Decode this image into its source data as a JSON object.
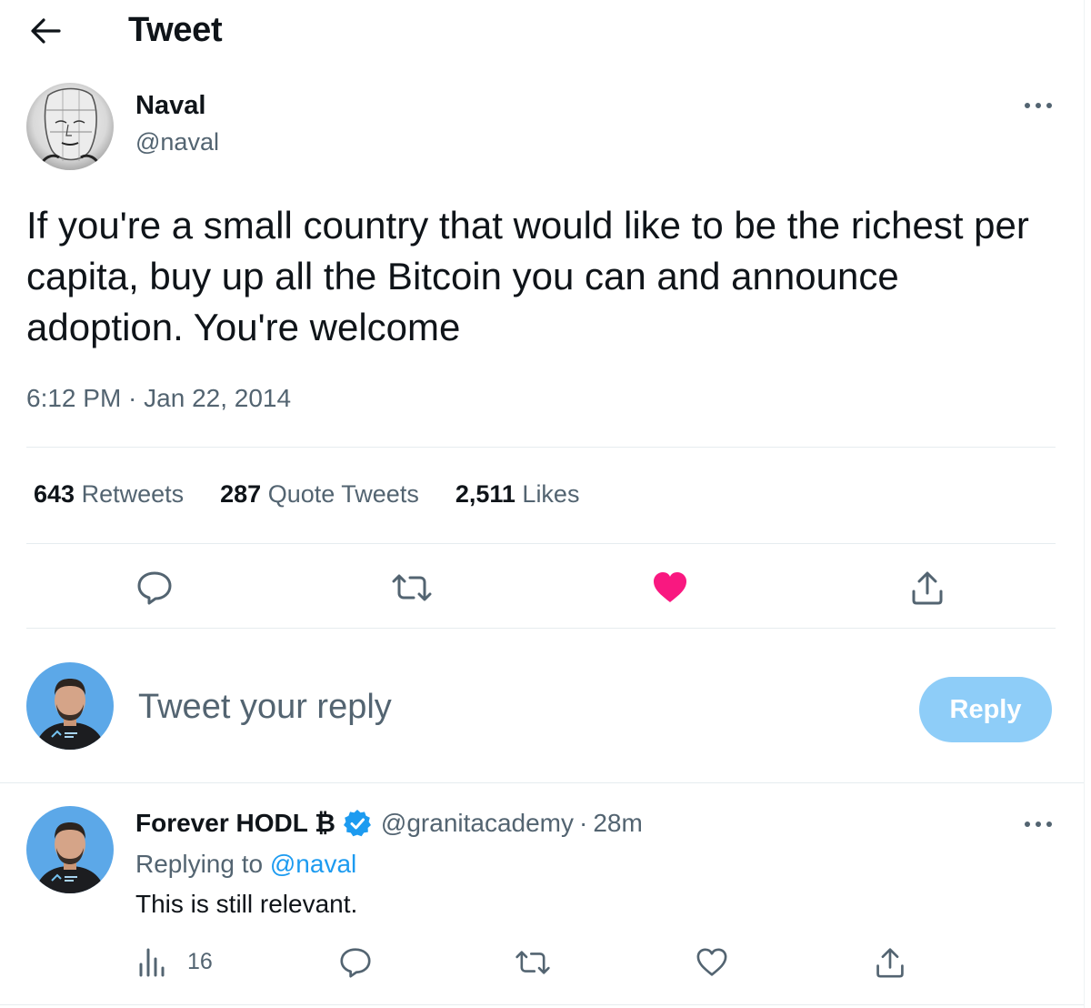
{
  "header": {
    "title": "Tweet"
  },
  "tweet": {
    "author_name": "Naval",
    "author_handle": "@naval",
    "text": "If you're a small country that would like to be the richest per capita, buy up all the Bitcoin you can and announce adoption. You're welcome",
    "timestamp": "6:12 PM · Jan 22, 2014",
    "stats": {
      "retweets_count": "643",
      "retweets_label": "Retweets",
      "quotes_count": "287",
      "quotes_label": "Quote Tweets",
      "likes_count": "2,511",
      "likes_label": "Likes"
    },
    "liked": true
  },
  "composer": {
    "placeholder": "Tweet your reply",
    "button_label": "Reply"
  },
  "reply": {
    "author_name": "Forever HODL ₿",
    "verified": true,
    "author_handle": "@granitacademy",
    "separator": "·",
    "time": "28m",
    "replying_prefix": "Replying to",
    "replying_to": "@naval",
    "text": "This is still relevant.",
    "views_count": "16"
  },
  "colors": {
    "text_primary": "#0f1419",
    "text_secondary": "#536471",
    "accent": "#1d9bf0",
    "like": "#f91880",
    "reply_button_disabled": "#8ecdf8",
    "divider": "#e6ecef"
  },
  "icons": [
    "back-arrow-icon",
    "more-dots-icon",
    "comment-icon",
    "retweet-icon",
    "heart-filled-icon",
    "share-icon",
    "verified-badge-icon",
    "views-icon",
    "heart-outline-icon"
  ]
}
